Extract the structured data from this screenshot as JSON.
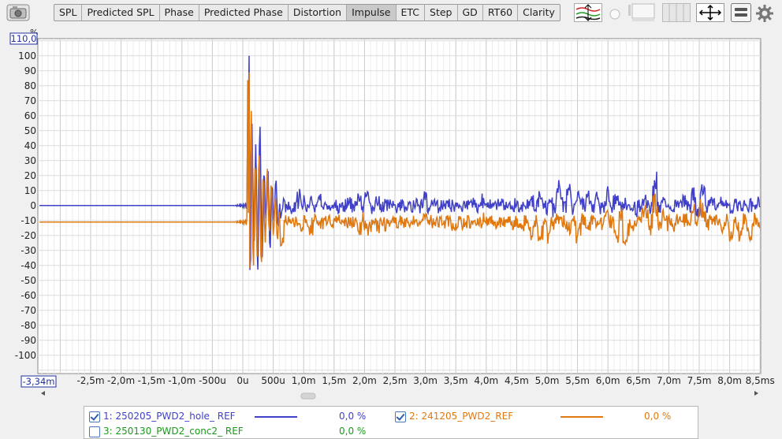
{
  "tabs": [
    {
      "label": "SPL",
      "active": false
    },
    {
      "label": "Predicted SPL",
      "active": false
    },
    {
      "label": "Phase",
      "active": false
    },
    {
      "label": "Predicted Phase",
      "active": false
    },
    {
      "label": "Distortion",
      "active": false
    },
    {
      "label": "Impulse",
      "active": true
    },
    {
      "label": "ETC",
      "active": false
    },
    {
      "label": "Step",
      "active": false
    },
    {
      "label": "GD",
      "active": false
    },
    {
      "label": "RT60",
      "active": false
    },
    {
      "label": "Clarity",
      "active": false
    }
  ],
  "icons": [
    "camera-icon",
    "trace-arrange-icon",
    "toggle-circle-icon",
    "window-icon",
    "grid-layout-icon",
    "fit-arrows-icon",
    "controls-icon",
    "gear-icon"
  ],
  "axis": {
    "y_unit": "%",
    "y_top_value": "110,0",
    "x_left_value": "-3,34m"
  },
  "chart_data": {
    "type": "line",
    "ylim": [
      -110,
      110
    ],
    "xlim": [
      -3.34,
      8.5
    ],
    "y_ticks": [
      "100",
      "90",
      "80",
      "70",
      "60",
      "50",
      "40",
      "30",
      "20",
      "10",
      "0",
      "-10",
      "-20",
      "-30",
      "-40",
      "-50",
      "-60",
      "-70",
      "-80",
      "-90",
      "-100"
    ],
    "x_ticks": [
      "-2,5m",
      "-2,0m",
      "-1,5m",
      "-1,0m",
      "-500u",
      "0u",
      "500u",
      "1,0m",
      "1,5m",
      "2,0m",
      "2,5m",
      "3,0m",
      "3,5m",
      "4,0m",
      "4,5m",
      "5,0m",
      "5,5m",
      "6,0m",
      "6,5m",
      "7,0m",
      "7,5m",
      "8,0m",
      "8,5ms"
    ],
    "series": [
      {
        "name": "1: 250205_PWD2_hole_ REF",
        "color": "#4040c8",
        "offset": 0,
        "peak": 100,
        "min": -43,
        "points": [
          [
            -3.34,
            0
          ],
          [
            -0.3,
            0
          ],
          [
            -0.1,
            1
          ],
          [
            0.0,
            -4
          ],
          [
            0.06,
            30
          ],
          [
            0.08,
            -25
          ],
          [
            0.1,
            100
          ],
          [
            0.13,
            -40
          ],
          [
            0.18,
            60
          ],
          [
            0.23,
            -43
          ],
          [
            0.28,
            55
          ],
          [
            0.33,
            -40
          ],
          [
            0.38,
            40
          ],
          [
            0.45,
            -30
          ],
          [
            0.52,
            20
          ],
          [
            0.6,
            -15
          ],
          [
            0.7,
            12
          ],
          [
            0.8,
            -8
          ],
          [
            0.9,
            18
          ],
          [
            1.0,
            -10
          ],
          [
            1.2,
            10
          ],
          [
            1.5,
            -5
          ],
          [
            2.0,
            8
          ],
          [
            2.5,
            -3
          ],
          [
            3.0,
            6
          ],
          [
            3.5,
            -2
          ],
          [
            4.0,
            5
          ],
          [
            4.5,
            -4
          ],
          [
            4.9,
            10
          ],
          [
            5.0,
            -5
          ],
          [
            5.1,
            20
          ],
          [
            5.5,
            8
          ],
          [
            6.0,
            10
          ],
          [
            6.5,
            -5
          ],
          [
            6.8,
            22
          ],
          [
            7.0,
            -5
          ],
          [
            7.5,
            15
          ],
          [
            8.0,
            -3
          ],
          [
            8.5,
            2
          ]
        ]
      },
      {
        "name": "2: 241205_PWD2_REF",
        "color": "#e07810",
        "offset": -11,
        "peak": 89,
        "min": -42,
        "points": [
          [
            -3.34,
            -11
          ],
          [
            -0.3,
            -11
          ],
          [
            0.0,
            -15
          ],
          [
            0.06,
            -38
          ],
          [
            0.08,
            89
          ],
          [
            0.11,
            -42
          ],
          [
            0.15,
            50
          ],
          [
            0.2,
            -35
          ],
          [
            0.25,
            25
          ],
          [
            0.3,
            -30
          ],
          [
            0.4,
            10
          ],
          [
            0.6,
            -35
          ],
          [
            0.8,
            -8
          ],
          [
            1.0,
            -22
          ],
          [
            1.5,
            -8
          ],
          [
            2.0,
            -18
          ],
          [
            2.5,
            -12
          ],
          [
            3.0,
            -6
          ],
          [
            3.5,
            -14
          ],
          [
            4.0,
            -8
          ],
          [
            4.5,
            -14
          ],
          [
            5.0,
            -28
          ],
          [
            5.1,
            -5
          ],
          [
            5.5,
            -25
          ],
          [
            6.0,
            0
          ],
          [
            6.2,
            -38
          ],
          [
            6.5,
            -8
          ],
          [
            6.8,
            15
          ],
          [
            7.0,
            -22
          ],
          [
            7.5,
            5
          ],
          [
            8.0,
            -25
          ],
          [
            8.5,
            -18
          ]
        ]
      }
    ]
  },
  "legend": [
    {
      "name": "1: 250205_PWD2_hole_ REF",
      "checked": true,
      "value": "0,0 %",
      "color": "#4040c8",
      "has_line": true
    },
    {
      "name": "2: 241205_PWD2_REF",
      "checked": true,
      "value": "0,0 %",
      "color": "#e07810",
      "has_line": true
    },
    {
      "name": "3: 250130_PWD2_conc2_ REF",
      "checked": false,
      "value": "0,0 %",
      "color": "#1a9a1a",
      "has_line": false
    }
  ]
}
